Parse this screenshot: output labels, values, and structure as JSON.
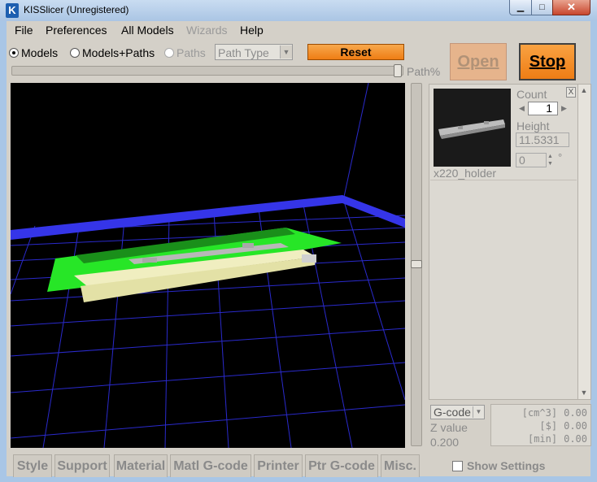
{
  "window": {
    "title": "KISSlicer (Unregistered)",
    "icon_letter": "K"
  },
  "caption_buttons": {
    "minimize": "▁",
    "maximize": "□",
    "close": "✕"
  },
  "menu": [
    "File",
    "Preferences",
    "All Models",
    "Wizards",
    "Help"
  ],
  "view_modes": {
    "options": [
      "Models",
      "Models+Paths",
      "Paths"
    ],
    "selected": "Models",
    "path_type_placeholder": "Path Type"
  },
  "buttons": {
    "reset": "Reset",
    "open": "Open",
    "stop": "Stop"
  },
  "path_slider": {
    "label": "Path%",
    "value_fraction": 1.0
  },
  "z_slider": {
    "value_fraction": 0.5
  },
  "model": {
    "name": "x220_holder",
    "count_label": "Count",
    "count": "1",
    "height_label": "Height",
    "height": "11.5331",
    "rotation": "0",
    "degree_symbol": "°",
    "close_label": "X"
  },
  "output": {
    "format": "G-code",
    "z_value_label": "Z value",
    "z_value": "0.200",
    "stats": [
      {
        "unit": "[cm^3]",
        "value": "0.00"
      },
      {
        "unit": "[$]",
        "value": "0.00"
      },
      {
        "unit": "[min]",
        "value": "0.00"
      }
    ]
  },
  "tabs": [
    "Style",
    "Support",
    "Material",
    "Matl G-code",
    "Printer",
    "Ptr G-code",
    "Misc."
  ],
  "show_settings": {
    "label": "Show Settings",
    "checked": false
  },
  "colors": {
    "bed_border": "#3535e8",
    "grid_line": "#2a2acc",
    "footprint": "#27e627",
    "model_body": "#e8e6a8",
    "model_top": "#a8a8a8",
    "accent_orange": "#ef7d14"
  }
}
